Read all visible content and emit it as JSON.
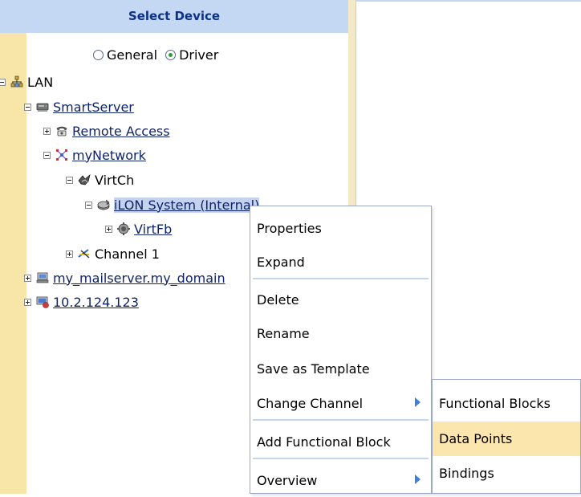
{
  "header": {
    "title": "Select Device"
  },
  "mode": {
    "options": [
      "General",
      "Driver"
    ],
    "selected": "Driver"
  },
  "tree": {
    "lan": "LAN",
    "smartserver": "SmartServer",
    "remote_access": "Remote Access",
    "mynetwork": "myNetwork",
    "virtch": "VirtCh",
    "ilon_system": "iLON System (Internal)",
    "virtfb": "VirtFb",
    "channel1": "Channel 1",
    "mailserver": "my_mailserver.my_domain",
    "ip_device": "10.2.124.123"
  },
  "context_menu": {
    "items": [
      "Properties",
      "Expand",
      "Delete",
      "Rename",
      "Save as Template",
      "Change Channel",
      "Add Functional Block",
      "Overview"
    ]
  },
  "submenu": {
    "items": [
      "Functional Blocks",
      "Data Points",
      "Bindings"
    ],
    "highlighted": "Data Points"
  },
  "colors": {
    "header_bg": "#c4d8f4",
    "header_text": "#0b3288",
    "left_strip": "#f8e6a8",
    "menu_highlight": "#fbe7ad",
    "submenu_arrow": "#3f7fd9"
  }
}
